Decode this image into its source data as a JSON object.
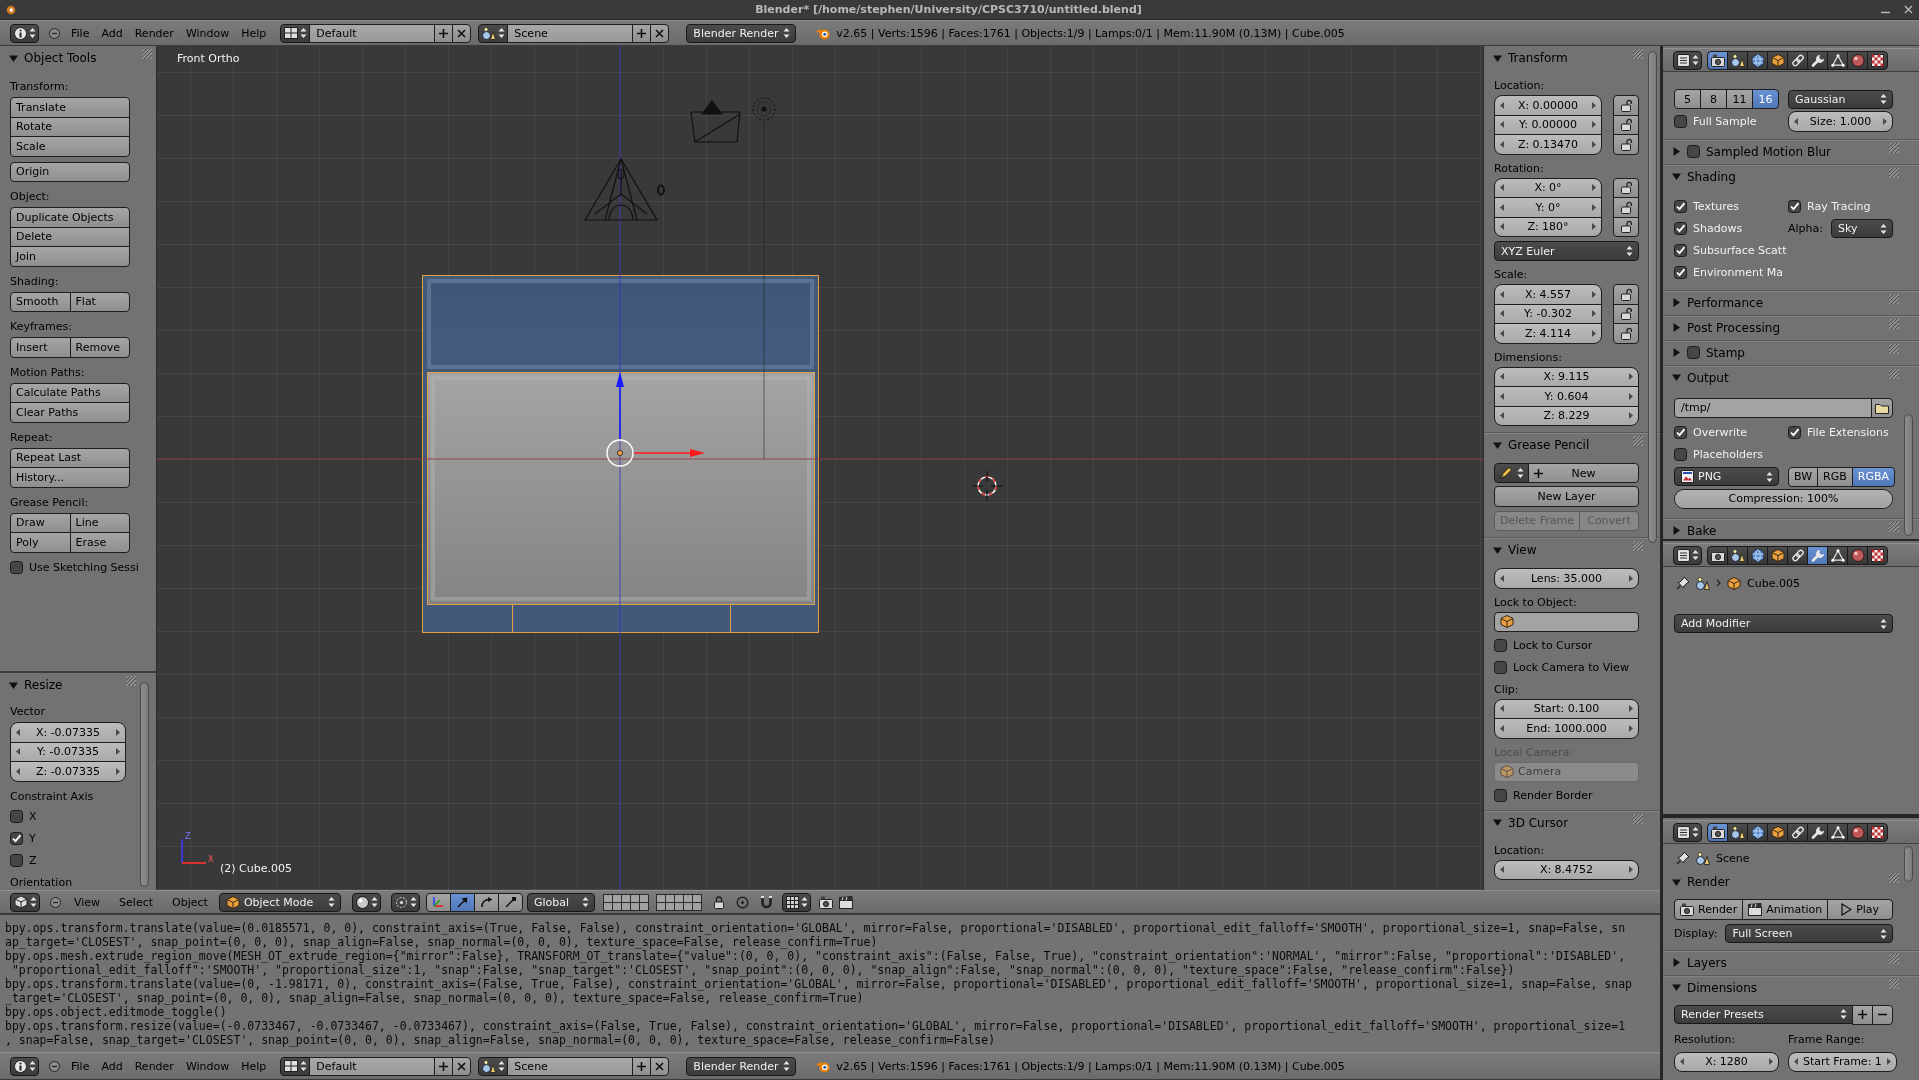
{
  "window": {
    "title": "Blender* [/home/stephen/University/CPSC3710/untitled.blend]"
  },
  "top_header": {
    "menus": [
      "File",
      "Add",
      "Render",
      "Window",
      "Help"
    ],
    "screen_layout": "Default",
    "scene": "Scene",
    "render_engine": "Blender Render",
    "stats": "v2.65 | Verts:1596 | Faces:1761 | Objects:1/9 | Lamps:0/1 | Mem:11.90M (0.13M) | Cube.005"
  },
  "tool_shelf": {
    "panels": [
      {
        "title": "Object Tools",
        "expanded": true,
        "items": [
          {
            "kind": "label",
            "text": "Transform:"
          },
          {
            "kind": "buttons",
            "rows": [
              [
                {
                  "label": "Translate"
                }
              ],
              [
                {
                  "label": "Rotate"
                }
              ],
              [
                {
                  "label": "Scale"
                }
              ]
            ]
          },
          {
            "kind": "buttons",
            "rows": [
              [
                {
                  "label": "Origin"
                }
              ]
            ]
          },
          {
            "kind": "label",
            "text": "Object:"
          },
          {
            "kind": "buttons",
            "rows": [
              [
                {
                  "label": "Duplicate Objects"
                }
              ],
              [
                {
                  "label": "Delete"
                }
              ],
              [
                {
                  "label": "Join"
                }
              ]
            ]
          },
          {
            "kind": "label",
            "text": "Shading:"
          },
          {
            "kind": "buttons",
            "rows": [
              [
                {
                  "label": "Smooth"
                },
                {
                  "label": "Flat"
                }
              ]
            ]
          },
          {
            "kind": "label",
            "text": "Keyframes:"
          },
          {
            "kind": "buttons",
            "rows": [
              [
                {
                  "label": "Insert"
                },
                {
                  "label": "Remove"
                }
              ]
            ]
          },
          {
            "kind": "label",
            "text": "Motion Paths:"
          },
          {
            "kind": "buttons",
            "rows": [
              [
                {
                  "label": "Calculate Paths"
                }
              ],
              [
                {
                  "label": "Clear Paths"
                }
              ]
            ]
          },
          {
            "kind": "label",
            "text": "Repeat:"
          },
          {
            "kind": "buttons",
            "rows": [
              [
                {
                  "label": "Repeat Last"
                }
              ],
              [
                {
                  "label": "History..."
                }
              ]
            ]
          },
          {
            "kind": "label",
            "text": "Grease Pencil:"
          },
          {
            "kind": "buttons",
            "rows": [
              [
                {
                  "label": "Draw"
                },
                {
                  "label": "Line"
                }
              ],
              [
                {
                  "label": "Poly"
                },
                {
                  "label": "Erase"
                }
              ]
            ]
          },
          {
            "kind": "checkbox",
            "label": "Use Sketching Sessi",
            "checked": false
          }
        ]
      }
    ],
    "operator_panel": {
      "title": "Resize",
      "expanded": true,
      "items": [
        {
          "kind": "label",
          "text": "Vector"
        },
        {
          "kind": "numbers",
          "fields": [
            {
              "value": "X: -0.07335"
            },
            {
              "value": "Y: -0.07335"
            },
            {
              "value": "Z: -0.07335"
            }
          ]
        },
        {
          "kind": "label",
          "text": "Constraint Axis"
        },
        {
          "kind": "checkbox",
          "label": "X",
          "checked": false
        },
        {
          "kind": "checkbox",
          "label": "Y",
          "checked": true
        },
        {
          "kind": "checkbox",
          "label": "Z",
          "checked": false
        },
        {
          "kind": "label",
          "text": "Orientation"
        }
      ]
    }
  },
  "viewport": {
    "view_name": "Front Ortho",
    "object_name": "(2) Cube.005",
    "axis_labels": [
      "Z",
      "X"
    ]
  },
  "view_properties": {
    "panels": [
      {
        "title": "Transform",
        "expanded": true,
        "items": [
          {
            "kind": "label",
            "text": "Location:"
          },
          {
            "kind": "numbers",
            "fields": [
              {
                "value": "X: 0.00000",
                "locked": false
              },
              {
                "value": "Y: 0.00000",
                "locked": false
              },
              {
                "value": "Z: 0.13470",
                "locked": false
              }
            ]
          },
          {
            "kind": "label",
            "text": "Rotation:"
          },
          {
            "kind": "numbers",
            "fields": [
              {
                "value": "X: 0°",
                "locked": false
              },
              {
                "value": "Y: 0°",
                "locked": false
              },
              {
                "value": "Z: 180°",
                "locked": false
              }
            ]
          },
          {
            "kind": "dropdown",
            "value": "XYZ Euler"
          },
          {
            "kind": "label",
            "text": "Scale:"
          },
          {
            "kind": "numbers",
            "fields": [
              {
                "value": "X: 4.557",
                "locked": false
              },
              {
                "value": "Y: -0.302",
                "locked": false
              },
              {
                "value": "Z: 4.114",
                "locked": false
              }
            ]
          },
          {
            "kind": "label",
            "text": "Dimensions:"
          },
          {
            "kind": "numbers",
            "fields": [
              {
                "value": "X: 9.115"
              },
              {
                "value": "Y: 0.604"
              },
              {
                "value": "Z: 8.229"
              }
            ]
          }
        ]
      },
      {
        "title": "Grease Pencil",
        "expanded": true,
        "items": [
          {
            "kind": "new_datablock",
            "label": "New"
          },
          {
            "kind": "buttons",
            "rows": [
              [
                {
                  "label": "New Layer",
                  "disabled": false
                }
              ]
            ]
          },
          {
            "kind": "buttons",
            "rows": [
              [
                {
                  "label": "Delete Frame",
                  "disabled": true
                },
                {
                  "label": "Convert",
                  "disabled": true
                }
              ]
            ]
          }
        ]
      },
      {
        "title": "View",
        "expanded": true,
        "items": [
          {
            "kind": "numbers",
            "fields": [
              {
                "value": "Lens: 35.000"
              }
            ]
          },
          {
            "kind": "label",
            "text": "Lock to Object:",
            "disabled": false
          },
          {
            "kind": "object_field",
            "disabled": false
          },
          {
            "kind": "checkbox",
            "label": "Lock to Cursor",
            "checked": false
          },
          {
            "kind": "checkbox",
            "label": "Lock Camera to View",
            "checked": false
          },
          {
            "kind": "label",
            "text": "Clip:",
            "disabled": false
          },
          {
            "kind": "numbers",
            "fields": [
              {
                "value": "Start: 0.100"
              },
              {
                "value": "End: 1000.000"
              }
            ]
          },
          {
            "kind": "label",
            "text": "Local Camera:",
            "disabled": true
          },
          {
            "kind": "object_field",
            "value": "Camera",
            "disabled": true
          },
          {
            "kind": "checkbox",
            "label": "Render Border",
            "checked": false
          }
        ]
      },
      {
        "title": "3D Cursor",
        "expanded": true,
        "items": [
          {
            "kind": "label",
            "text": "Location:"
          },
          {
            "kind": "numbers",
            "fields": [
              {
                "value": "X: 8.4752"
              }
            ]
          }
        ]
      }
    ]
  },
  "properties": [
    {
      "tabs": [
        {
          "kind": "render",
          "selected": true
        },
        {
          "kind": "scene",
          "selected": false
        },
        {
          "kind": "world",
          "selected": false
        },
        {
          "kind": "object",
          "selected": false
        },
        {
          "kind": "constraints",
          "selected": false
        },
        {
          "kind": "modifiers",
          "selected": false
        },
        {
          "kind": "data",
          "selected": false
        },
        {
          "kind": "material",
          "selected": false
        },
        {
          "kind": "texture",
          "selected": false
        }
      ],
      "panels": [
        {
          "items": [
            {
              "kind": "row",
              "cells": [
                {
                  "kind": "toggles",
                  "options": [
                    {
                      "label": "5",
                      "selected": false
                    },
                    {
                      "label": "8",
                      "selected": false
                    },
                    {
                      "label": "11",
                      "selected": false
                    },
                    {
                      "label": "16",
                      "selected": true
                    }
                  ]
                },
                {
                  "kind": "dropdown",
                  "value": "Gaussian"
                }
              ]
            },
            {
              "kind": "row",
              "cells": [
                {
                  "kind": "checkbox",
                  "label": "Full Sample",
                  "checked": false
                },
                {
                  "kind": "numbers",
                  "fields": [
                    {
                      "value": "Size: 1.000"
                    }
                  ]
                }
              ]
            }
          ]
        },
        {
          "title": "Sampled Motion Blur",
          "expanded": false,
          "checked": false
        },
        {
          "title": "Shading",
          "expanded": true,
          "items": [
            {
              "kind": "row",
              "cells": [
                {
                  "kind": "checkbox",
                  "label": "Textures",
                  "checked": true
                },
                {
                  "kind": "checkbox",
                  "label": "Ray Tracing",
                  "checked": true
                }
              ]
            },
            {
              "kind": "row",
              "cells": [
                {
                  "kind": "checkbox",
                  "label": "Shadows",
                  "checked": true
                },
                {
                  "kind": "labeled_dropdown",
                  "label": "Alpha:",
                  "value": "Sky"
                }
              ]
            },
            {
              "kind": "checkbox",
              "label": "Subsurface Scatt",
              "checked": true
            },
            {
              "kind": "checkbox",
              "label": "Environment Ma",
              "checked": true
            }
          ]
        },
        {
          "title": "Performance",
          "expanded": false
        },
        {
          "title": "Post Processing",
          "expanded": false
        },
        {
          "title": "Stamp",
          "expanded": false,
          "checked": false
        },
        {
          "title": "Output",
          "expanded": true,
          "items": [
            {
              "kind": "path_field",
              "value": "/tmp/"
            },
            {
              "kind": "row",
              "cells": [
                {
                  "kind": "checkbox",
                  "label": "Overwrite",
                  "checked": true
                },
                {
                  "kind": "checkbox",
                  "label": "File Extensions",
                  "checked": true
                }
              ]
            },
            {
              "kind": "checkbox",
              "label": "Placeholders",
              "checked": false
            },
            {
              "kind": "row",
              "cells": [
                {
                  "kind": "format_dropdown",
                  "value": "PNG"
                },
                {
                  "kind": "toggles",
                  "options": [
                    {
                      "label": "BW",
                      "selected": false
                    },
                    {
                      "label": "RGB",
                      "selected": false
                    },
                    {
                      "label": "RGBA",
                      "selected": true
                    }
                  ]
                }
              ]
            },
            {
              "kind": "slider",
              "label": "Compression: 100%",
              "level": 1
            }
          ]
        },
        {
          "title": "Bake",
          "expanded": false
        }
      ]
    },
    {
      "tabs": [
        {
          "kind": "render",
          "selected": false
        },
        {
          "kind": "scene",
          "selected": false
        },
        {
          "kind": "world",
          "selected": false
        },
        {
          "kind": "object",
          "selected": false
        },
        {
          "kind": "constraints",
          "selected": false
        },
        {
          "kind": "modifiers",
          "selected": true
        },
        {
          "kind": "data",
          "selected": false
        },
        {
          "kind": "material",
          "selected": false
        },
        {
          "kind": "texture",
          "selected": false
        }
      ],
      "context": {
        "pinned": false,
        "path": [
          {
            "kind": "scene"
          },
          {
            "kind": "object",
            "label": "Cube.005"
          }
        ]
      },
      "panels": [
        {
          "items": [
            {
              "kind": "dropdown",
              "value": "Add Modifier"
            }
          ]
        }
      ]
    },
    {
      "tabs": [
        {
          "kind": "render",
          "selected": true
        },
        {
          "kind": "scene",
          "selected": false
        },
        {
          "kind": "world",
          "selected": false
        },
        {
          "kind": "object",
          "selected": false
        },
        {
          "kind": "constraints",
          "selected": false
        },
        {
          "kind": "modifiers",
          "selected": false
        },
        {
          "kind": "data",
          "selected": false
        },
        {
          "kind": "material",
          "selected": false
        },
        {
          "kind": "texture",
          "selected": false
        }
      ],
      "context": {
        "pinned": false,
        "path": [
          {
            "kind": "scene",
            "label": "Scene"
          }
        ]
      },
      "panels": [
        {
          "title": "Render",
          "expanded": true,
          "items": [
            {
              "kind": "buttons",
              "rows": [
                [
                  {
                    "kind": "render",
                    "label": "Render"
                  },
                  {
                    "kind": "animation",
                    "label": "Animation"
                  },
                  {
                    "kind": "play",
                    "label": "Play"
                  }
                ]
              ]
            },
            {
              "kind": "labeled_dropdown",
              "label": "Display:",
              "value": "Full Screen"
            }
          ]
        },
        {
          "title": "Layers",
          "expanded": false
        },
        {
          "title": "Dimensions",
          "expanded": true,
          "items": [
            {
              "kind": "presets",
              "value": "Render Presets"
            },
            {
              "kind": "row",
              "cells": [
                {
                  "kind": "label",
                  "text": "Resolution:"
                },
                {
                  "kind": "label",
                  "text": "Frame Range:"
                }
              ]
            },
            {
              "kind": "row",
              "cells": [
                {
                  "kind": "numbers",
                  "fields": [
                    {
                      "value": "X: 1280"
                    }
                  ]
                },
                {
                  "kind": "numbers",
                  "fields": [
                    {
                      "value": "Start Frame: 1"
                    }
                  ]
                }
              ]
            }
          ]
        }
      ]
    }
  ],
  "viewport_header": {
    "menus": [
      "View",
      "Select",
      "Object"
    ],
    "mode": "Object Mode",
    "transform_orientation": "Global",
    "manipulator_tools": [
      {
        "kind": "translate",
        "selected": true
      },
      {
        "kind": "rotate",
        "selected": false
      },
      {
        "kind": "scale",
        "selected": false
      }
    ]
  },
  "info_log": {
    "lines": [
      "bpy.ops.transform.translate(value=(0.0185571, 0, 0), constraint_axis=(True, False, False), constraint_orientation='GLOBAL', mirror=False, proportional='DISABLED', proportional_edit_falloff='SMOOTH', proportional_size=1, snap=False, sn",
      "ap_target='CLOSEST', snap_point=(0, 0, 0), snap_align=False, snap_normal=(0, 0, 0), texture_space=False, release_confirm=True)",
      "bpy.ops.mesh.extrude_region_move(MESH_OT_extrude_region={\"mirror\":False}, TRANSFORM_OT_translate={\"value\":(0, 0, 0), \"constraint_axis\":(False, False, True), \"constraint_orientation\":'NORMAL', \"mirror\":False, \"proportional\":'DISABLED',",
      " \"proportional_edit_falloff\":'SMOOTH', \"proportional_size\":1, \"snap\":False, \"snap_target\":'CLOSEST', \"snap_point\":(0, 0, 0), \"snap_align\":False, \"snap_normal\":(0, 0, 0), \"texture_space\":False, \"release_confirm\":False})",
      "bpy.ops.transform.translate(value=(0, -1.98171, 0), constraint_axis=(False, True, False), constraint_orientation='GLOBAL', mirror=False, proportional='DISABLED', proportional_edit_falloff='SMOOTH', proportional_size=1, snap=False, snap",
      "_target='CLOSEST', snap_point=(0, 0, 0), snap_align=False, snap_normal=(0, 0, 0), texture_space=False, release_confirm=True)",
      "bpy.ops.object.editmode_toggle()",
      "bpy.ops.transform.resize(value=(-0.0733467, -0.0733467, -0.0733467), constraint_axis=(False, True, False), constraint_orientation='GLOBAL', mirror=False, proportional='DISABLED', proportional_edit_falloff='SMOOTH', proportional_size=1",
      ", snap=False, snap_target='CLOSEST', snap_point=(0, 0, 0), snap_align=False, snap_normal=(0, 0, 0), texture_space=False, release_confirm=False)"
    ]
  },
  "bottom_header": {
    "menus": [
      "File",
      "Add",
      "Render",
      "Window",
      "Help"
    ],
    "screen_layout": "Default",
    "scene": "Scene",
    "render_engine": "Blender Render",
    "stats": "v2.65 | Verts:1596 | Faces:1761 | Objects:1/9 | Lamps:0/1 | Mem:11.90M (0.13M) | Cube.005"
  }
}
